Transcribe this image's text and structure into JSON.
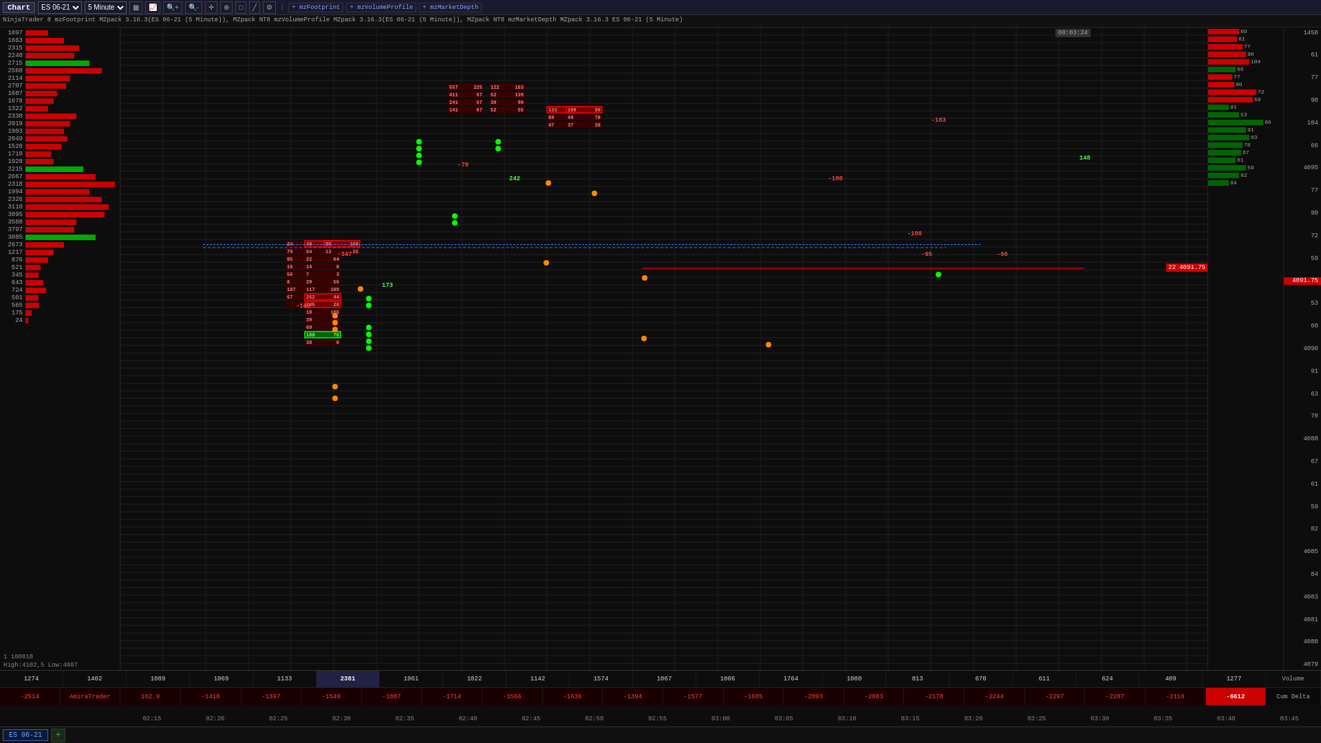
{
  "app": {
    "title": "Chart"
  },
  "toolbar": {
    "title": "Chart",
    "instrument": "ES 06-21",
    "timeframe": "5 Minute",
    "indicators": [
      "mzFootprint",
      "mzVolumeProfile",
      "mzMarketDepth"
    ],
    "buttons": [
      "bar-chart",
      "line",
      "zoom-in",
      "zoom-out",
      "crosshair",
      "magnet",
      "draw-rect",
      "draw-line",
      "fibs",
      "text",
      "measure",
      "arrows",
      "grid",
      "settings"
    ]
  },
  "infobar": {
    "text": "NinjaTrader 8 mzFootprint MZpack 3.16.3(ES 06-21 (5 Minute)), MZpack NT8 mzVolumeProfile MZpack 3.16.3(ES 06-21 (5 Minute)), MZpack NT8 mzMarketDepth MZpack 3.16.3 ES 06-21 (5 Minute)"
  },
  "chart": {
    "highlow": "High:4102,5 Low:4087",
    "info_bottom": "1 100818",
    "timer": "00:03:24",
    "current_price": "4091.75"
  },
  "left_profile": {
    "rows": [
      {
        "label": "1097",
        "value": 18,
        "type": "red"
      },
      {
        "label": "1663",
        "value": 30,
        "type": "red"
      },
      {
        "label": "2315",
        "value": 42,
        "type": "red"
      },
      {
        "label": "2240",
        "value": 38,
        "type": "red"
      },
      {
        "label": "2715",
        "value": 50,
        "type": "green"
      },
      {
        "label": "2568",
        "value": 60,
        "type": "red"
      },
      {
        "label": "2114",
        "value": 35,
        "type": "red"
      },
      {
        "label": "2707",
        "value": 32,
        "type": "red"
      },
      {
        "label": "1687",
        "value": 25,
        "type": "red"
      },
      {
        "label": "1678",
        "value": 22,
        "type": "red"
      },
      {
        "label": "1322",
        "value": 18,
        "type": "red"
      },
      {
        "label": "2330",
        "value": 40,
        "type": "red"
      },
      {
        "label": "2019",
        "value": 35,
        "type": "red"
      },
      {
        "label": "1903",
        "value": 30,
        "type": "red"
      },
      {
        "label": "2049",
        "value": 33,
        "type": "red"
      },
      {
        "label": "1520",
        "value": 28,
        "type": "red"
      },
      {
        "label": "1710",
        "value": 20,
        "type": "red"
      },
      {
        "label": "1928",
        "value": 22,
        "type": "red"
      },
      {
        "label": "2215",
        "value": 45,
        "type": "green"
      },
      {
        "label": "2667",
        "value": 55,
        "type": "red"
      },
      {
        "label": "2318",
        "value": 70,
        "type": "red"
      },
      {
        "label": "1994",
        "value": 50,
        "type": "red"
      },
      {
        "label": "2326",
        "value": 60,
        "type": "red"
      },
      {
        "label": "3110",
        "value": 65,
        "type": "red"
      },
      {
        "label": "3095",
        "value": 62,
        "type": "red"
      },
      {
        "label": "3588",
        "value": 40,
        "type": "red"
      },
      {
        "label": "3797",
        "value": 38,
        "type": "red"
      },
      {
        "label": "3085",
        "value": 55,
        "type": "green"
      },
      {
        "label": "2673",
        "value": 30,
        "type": "red"
      },
      {
        "label": "1217",
        "value": 22,
        "type": "red"
      },
      {
        "label": "876",
        "value": 18,
        "type": "red"
      },
      {
        "label": "521",
        "value": 12,
        "type": "red"
      },
      {
        "label": "345",
        "value": 10,
        "type": "red"
      },
      {
        "label": "643",
        "value": 14,
        "type": "red"
      },
      {
        "label": "724",
        "value": 16,
        "type": "red"
      },
      {
        "label": "501",
        "value": 10,
        "type": "red"
      },
      {
        "label": "565",
        "value": 11,
        "type": "red"
      },
      {
        "label": "175",
        "value": 5,
        "type": "red"
      },
      {
        "label": "24",
        "value": 2,
        "type": "red"
      }
    ]
  },
  "right_profile": {
    "rows": [
      {
        "value": 45,
        "type": "red",
        "label": "69"
      },
      {
        "value": 42,
        "type": "red",
        "label": "61"
      },
      {
        "value": 50,
        "type": "red",
        "label": "77"
      },
      {
        "value": 55,
        "type": "red",
        "label": "90"
      },
      {
        "value": 60,
        "type": "red",
        "label": "104"
      },
      {
        "value": 40,
        "type": "green",
        "label": "66"
      },
      {
        "value": 35,
        "type": "red",
        "label": "77"
      },
      {
        "value": 38,
        "type": "red",
        "label": "90"
      },
      {
        "value": 70,
        "type": "red",
        "label": "72"
      },
      {
        "value": 65,
        "type": "red",
        "label": "59"
      },
      {
        "value": 30,
        "type": "green",
        "label": "91"
      },
      {
        "value": 45,
        "type": "green",
        "label": "53"
      },
      {
        "value": 80,
        "type": "green",
        "label": "60"
      },
      {
        "value": 55,
        "type": "green",
        "label": "91"
      },
      {
        "value": 60,
        "type": "green",
        "label": "63"
      },
      {
        "value": 50,
        "type": "green",
        "label": "78"
      },
      {
        "value": 48,
        "type": "green",
        "label": "67"
      },
      {
        "value": 40,
        "type": "green",
        "label": "61"
      },
      {
        "value": 55,
        "type": "green",
        "label": "59"
      },
      {
        "value": 45,
        "type": "green",
        "label": "82"
      },
      {
        "value": 30,
        "type": "green",
        "label": "84"
      }
    ]
  },
  "price_axis": {
    "ticks": [
      "1450",
      "61",
      "77",
      "90",
      "104",
      "66",
      "4095",
      "77",
      "90",
      "72",
      "59",
      "4091.75",
      "53",
      "60",
      "4090",
      "91",
      "63",
      "78",
      "4088",
      "67",
      "61",
      "59",
      "82",
      "4085",
      "84",
      "4083",
      "4081",
      "4080",
      "4079"
    ]
  },
  "volume_row": {
    "cells": [
      {
        "value": "1274"
      },
      {
        "value": "1402"
      },
      {
        "value": "1089"
      },
      {
        "value": "1069"
      },
      {
        "value": "1133"
      },
      {
        "value": "2381",
        "highlight": true
      },
      {
        "value": "1961"
      },
      {
        "value": "1022"
      },
      {
        "value": "1142"
      },
      {
        "value": "1574"
      },
      {
        "value": "1067"
      },
      {
        "value": "1006"
      },
      {
        "value": "1764"
      },
      {
        "value": "1080"
      },
      {
        "value": "813"
      },
      {
        "value": "670"
      },
      {
        "value": "611"
      },
      {
        "value": "624"
      },
      {
        "value": "409"
      },
      {
        "value": "1277"
      },
      {
        "label": "Volume"
      }
    ]
  },
  "delta_row": {
    "cells": [
      {
        "value": "-2514",
        "type": "red"
      },
      {
        "value": "AmiraTrader",
        "type": "red"
      },
      {
        "value": "162.9",
        "type": "red"
      },
      {
        "value": "-1418",
        "type": "red"
      },
      {
        "value": "-1397",
        "type": "red"
      },
      {
        "value": "-1540",
        "type": "red"
      },
      {
        "value": "-1887",
        "type": "red"
      },
      {
        "value": "-1714",
        "type": "red"
      },
      {
        "value": "-1566",
        "type": "red"
      },
      {
        "value": "-1636",
        "type": "red"
      },
      {
        "value": "-1394",
        "type": "red"
      },
      {
        "value": "-1577",
        "type": "red"
      },
      {
        "value": "-1685",
        "type": "red"
      },
      {
        "value": "-2093",
        "type": "red"
      },
      {
        "value": "-2083",
        "type": "red"
      },
      {
        "value": "-2178",
        "type": "red"
      },
      {
        "value": "-2244",
        "type": "red"
      },
      {
        "value": "-2297",
        "type": "red"
      },
      {
        "value": "-2207",
        "type": "red"
      },
      {
        "value": "-2116",
        "type": "red"
      },
      {
        "value": "-6612",
        "type": "highlight-red"
      },
      {
        "label": "Cum Delta"
      }
    ]
  },
  "time_labels": [
    "02:15",
    "02:20",
    "02:25",
    "02:30",
    "02:35",
    "02:40",
    "02:45",
    "02:50",
    "02:55",
    "03:00",
    "03:05",
    "03:10",
    "03:15",
    "03:20",
    "03:25",
    "03:30",
    "03:35",
    "03:40",
    "03:45"
  ],
  "tabs": [
    {
      "label": "ES 06-21",
      "active": true
    }
  ]
}
